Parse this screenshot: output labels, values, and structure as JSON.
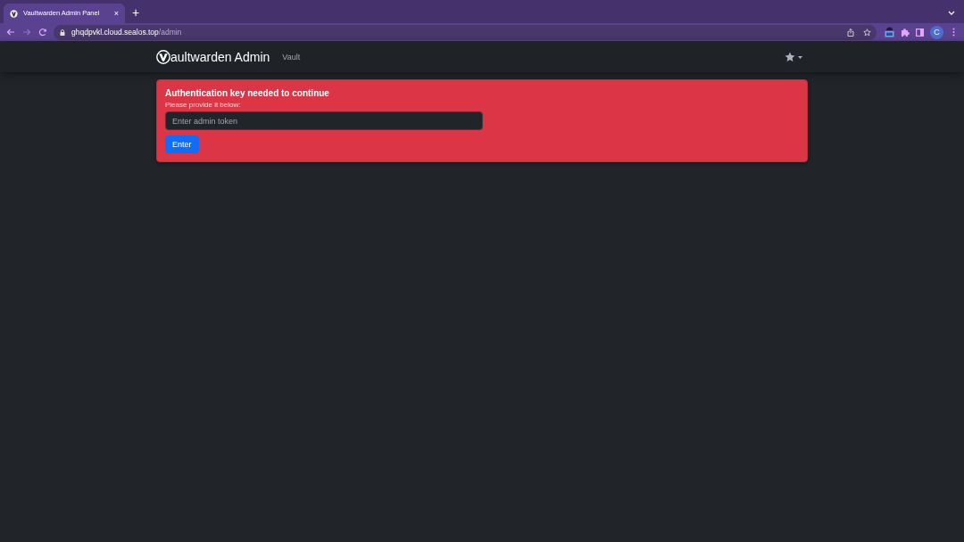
{
  "browser": {
    "tabs": [
      {
        "title": "Vaultwarden Admin Panel",
        "close": "×",
        "selected": true
      }
    ],
    "new_tab": "+",
    "nav_buttons": [
      {
        "kind": "back",
        "disabled": false
      },
      {
        "kind": "forward",
        "disabled": true
      },
      {
        "kind": "reload",
        "disabled": false
      }
    ],
    "url": {
      "host": "ghqdpvkl.cloud.sealos.top",
      "path": "/admin"
    },
    "profile": "C"
  },
  "navbar": {
    "brand": "aultwarden Admin",
    "links": [
      {
        "label": "Vault"
      }
    ]
  },
  "alert": {
    "title": "Authentication key needed to continue",
    "message": "Please provide it below:",
    "input": {
      "placeholder": "Enter admin token"
    },
    "button": "Enter"
  }
}
